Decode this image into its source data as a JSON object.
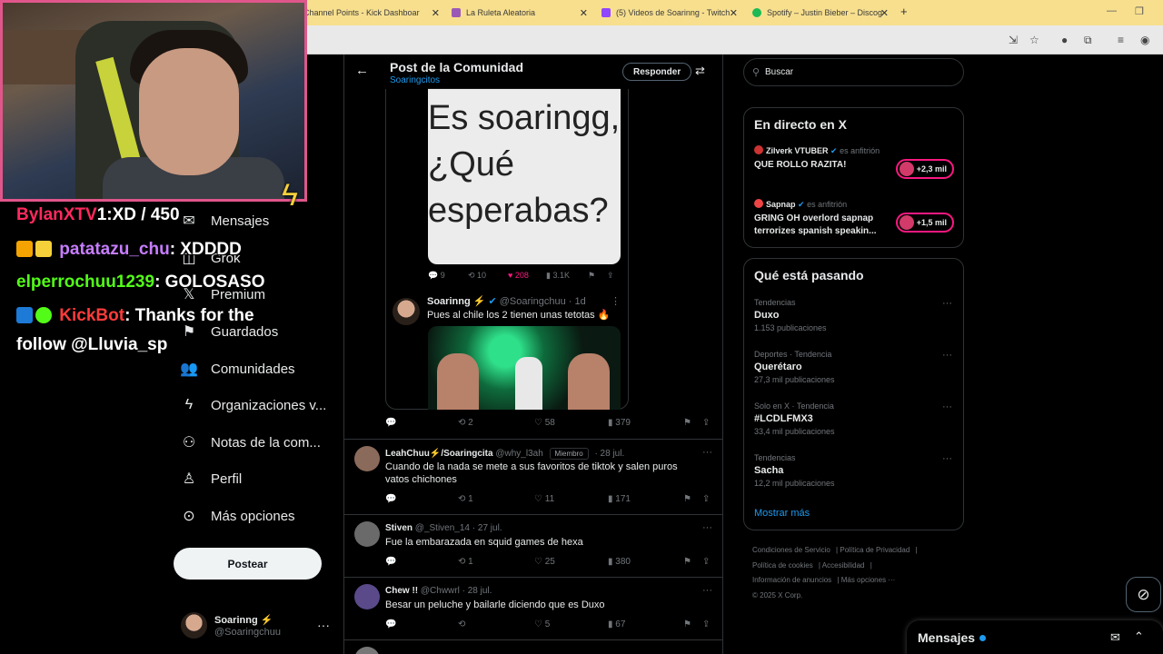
{
  "browser": {
    "tabs": [
      {
        "label": "Channel Points - Kick Dashboar",
        "color": "#53fc18"
      },
      {
        "label": "La Ruleta Aleatoria",
        "color": "#9b59b6"
      },
      {
        "label": "(5) Videos de Soarinng - Twitch",
        "color": "#9146ff"
      },
      {
        "label": "Spotify – Justin Bieber – Discog",
        "color": "#1db954"
      }
    ],
    "new_tab": "+",
    "close": "✕"
  },
  "overlay": {
    "chat": [
      {
        "user": "BylanXTV",
        "user_color": "#ff2a5e",
        "message": ": XD",
        "extra": "1:XD / 450"
      },
      {
        "user": "patatazu_chu",
        "user_color": "#c77dff",
        "message": ": XDDDD"
      },
      {
        "user": "elperrochuu1239",
        "user_color": "#53fc18",
        "message": ": GOLOSASO"
      },
      {
        "user": "KickBot",
        "user_color": "#ff3b3b",
        "message": ": Thanks for the follow @Lluvia_sp"
      }
    ]
  },
  "nav": {
    "items": [
      {
        "label": "Mensajes",
        "icon": "envelope-icon"
      },
      {
        "label": "Grok",
        "icon": "grok-icon"
      },
      {
        "label": "Premium",
        "icon": "x-logo-icon"
      },
      {
        "label": "Guardados",
        "icon": "bookmark-icon"
      },
      {
        "label": "Comunidades",
        "icon": "people-icon"
      },
      {
        "label": "Organizaciones v...",
        "icon": "lightning-icon"
      },
      {
        "label": "Notas de la com...",
        "icon": "community-notes-icon"
      },
      {
        "label": "Perfil",
        "icon": "person-icon"
      },
      {
        "label": "Más opciones",
        "icon": "more-circle-icon"
      }
    ],
    "post_button": "Postear",
    "account": {
      "name": "Soarinng ⚡",
      "handle": "@Soaringchuu"
    }
  },
  "header": {
    "title": "Post de la Comunidad",
    "subtitle": "Soaringcitos",
    "reply_button": "Responder"
  },
  "quoted": {
    "meme_lines": [
      "Es soaringg,",
      "¿Qué",
      "esperabas?"
    ],
    "stats": {
      "replies": "9",
      "reposts": "10",
      "likes": "208",
      "views": "3.1K"
    },
    "tweet": {
      "name": "Soarinng ⚡",
      "handle": "@Soaringchuu · 1d",
      "text": "Pues al chile los 2 tienen unas tetotas 🔥"
    }
  },
  "main_actions": {
    "reposts": "2",
    "likes": "58",
    "views": "379"
  },
  "replies": [
    {
      "name": "LeahChuu⚡/Soaringcita",
      "handle": "@why_l3ah",
      "badge": "Miembro",
      "date": "· 28 jul.",
      "text": "Cuando de la nada se mete a sus favoritos de tiktok y salen puros vatos chichones",
      "reposts": "1",
      "likes": "11",
      "views": "171",
      "avatar": "#8a6a5a"
    },
    {
      "name": "Stiven",
      "handle": "@_Stiven_14",
      "badge": "",
      "date": "· 27 jul.",
      "text": "Fue la embarazada en squid games de hexa",
      "reposts": "1",
      "likes": "25",
      "views": "380",
      "avatar": "#6a6a6a"
    },
    {
      "name": "Chew !!",
      "handle": "@Chwwrl",
      "badge": "",
      "date": "· 28 jul.",
      "text": "Besar un peluche y bailarle diciendo que es Duxo",
      "reposts": "",
      "likes": "5",
      "views": "67",
      "avatar": "#5a4a8a"
    }
  ],
  "right": {
    "search_placeholder": "Buscar",
    "live_title": "En directo en X",
    "live": [
      {
        "host": "Zilverk VTUBER",
        "suffix": "es anfitrión",
        "title": "QUE ROLLO RAZITA!",
        "count": "+2,3 mil"
      },
      {
        "host": "Sapnap",
        "suffix": "es anfitrión",
        "title": "GRING OH overlord sapnap terrorizes spanish speakin...",
        "count": "+1,5 mil"
      }
    ],
    "trends_title": "Qué está pasando",
    "trends": [
      {
        "category": "Tendencias",
        "name": "Duxo",
        "count": "1.153 publicaciones"
      },
      {
        "category": "Deportes · Tendencia",
        "name": "Querétaro",
        "count": "27,3 mil publicaciones"
      },
      {
        "category": "Solo en X · Tendencia",
        "name": "#LCDLFMX3",
        "count": "33,4 mil publicaciones"
      },
      {
        "category": "Tendencias",
        "name": "Sacha",
        "count": "12,2 mil publicaciones"
      }
    ],
    "show_more": "Mostrar más",
    "footer": [
      "Condiciones de Servicio",
      "Política de Privacidad",
      "Política de cookies",
      "Accesibilidad",
      "Información de anuncios",
      "Más opciones ···",
      "© 2025 X Corp."
    ],
    "messages_drawer": "Mensajes"
  },
  "colors": {
    "accent": "#1d9bf0",
    "like": "#f91880",
    "overlay_border": "#e0568b"
  }
}
